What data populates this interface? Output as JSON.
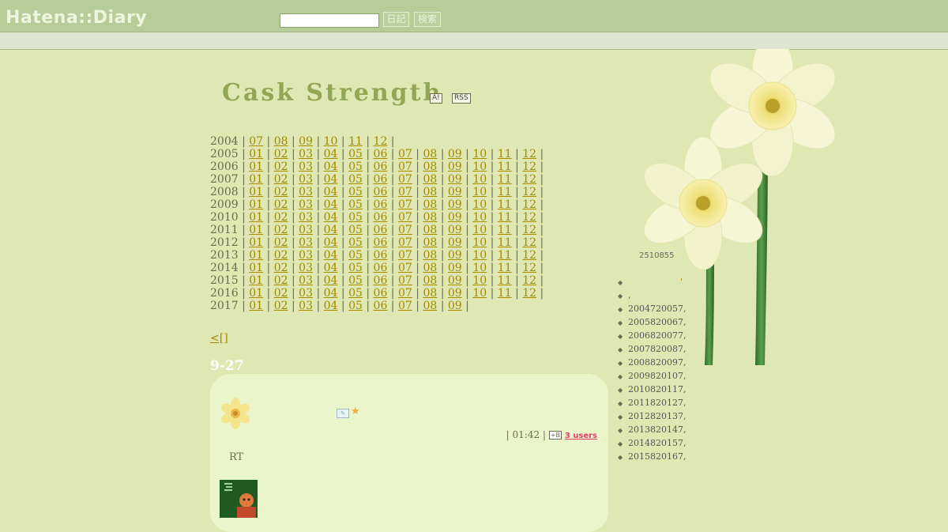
{
  "header": {
    "logo": "Hatena::Diary",
    "search_value": "",
    "diary_button": "日記",
    "search_button": "検索"
  },
  "blog": {
    "title": "Cask Strength",
    "antenna_badge": "A!",
    "rss_badge": "RSS"
  },
  "archive": [
    {
      "year": "2004",
      "months": [
        "07",
        "08",
        "09",
        "10",
        "11",
        "12"
      ]
    },
    {
      "year": "2005",
      "months": [
        "01",
        "02",
        "03",
        "04",
        "05",
        "06",
        "07",
        "08",
        "09",
        "10",
        "11",
        "12"
      ]
    },
    {
      "year": "2006",
      "months": [
        "01",
        "02",
        "03",
        "04",
        "05",
        "06",
        "07",
        "08",
        "09",
        "10",
        "11",
        "12"
      ]
    },
    {
      "year": "2007",
      "months": [
        "01",
        "02",
        "03",
        "04",
        "05",
        "06",
        "07",
        "08",
        "09",
        "10",
        "11",
        "12"
      ]
    },
    {
      "year": "2008",
      "months": [
        "01",
        "02",
        "03",
        "04",
        "05",
        "06",
        "07",
        "08",
        "09",
        "10",
        "11",
        "12"
      ]
    },
    {
      "year": "2009",
      "months": [
        "01",
        "02",
        "03",
        "04",
        "05",
        "06",
        "07",
        "08",
        "09",
        "10",
        "11",
        "12"
      ]
    },
    {
      "year": "2010",
      "months": [
        "01",
        "02",
        "03",
        "04",
        "05",
        "06",
        "07",
        "08",
        "09",
        "10",
        "11",
        "12"
      ]
    },
    {
      "year": "2011",
      "months": [
        "01",
        "02",
        "03",
        "04",
        "05",
        "06",
        "07",
        "08",
        "09",
        "10",
        "11",
        "12"
      ]
    },
    {
      "year": "2012",
      "months": [
        "01",
        "02",
        "03",
        "04",
        "05",
        "06",
        "07",
        "08",
        "09",
        "10",
        "11",
        "12"
      ]
    },
    {
      "year": "2013",
      "months": [
        "01",
        "02",
        "03",
        "04",
        "05",
        "06",
        "07",
        "08",
        "09",
        "10",
        "11",
        "12"
      ]
    },
    {
      "year": "2014",
      "months": [
        "01",
        "02",
        "03",
        "04",
        "05",
        "06",
        "07",
        "08",
        "09",
        "10",
        "11",
        "12"
      ]
    },
    {
      "year": "2015",
      "months": [
        "01",
        "02",
        "03",
        "04",
        "05",
        "06",
        "07",
        "08",
        "09",
        "10",
        "11",
        "12"
      ]
    },
    {
      "year": "2016",
      "months": [
        "01",
        "02",
        "03",
        "04",
        "05",
        "06",
        "07",
        "08",
        "09",
        "10",
        "11",
        "12"
      ]
    },
    {
      "year": "2017",
      "months": [
        "01",
        "02",
        "03",
        "04",
        "05",
        "06",
        "07",
        "08",
        "09"
      ]
    }
  ],
  "nav": {
    "prev_link": "<[]"
  },
  "entry": {
    "date": "9-27",
    "time": "| 01:42 |",
    "bookmark_icon": "+B",
    "bookmark_users": "3 users",
    "body_text": "RT",
    "icons": [
      "daffodil-icon",
      "edit-icon",
      "star-icon"
    ]
  },
  "sidebar": {
    "counter": "2510855",
    "items": [
      {
        "text": "",
        "extra": "'"
      },
      {
        "text": ",",
        "extra": ""
      },
      {
        "text": "2004720057,",
        "extra": ""
      },
      {
        "text": "2005820067,",
        "extra": ""
      },
      {
        "text": "2006820077,",
        "extra": ""
      },
      {
        "text": "2007820087,",
        "extra": ""
      },
      {
        "text": "2008820097,",
        "extra": ""
      },
      {
        "text": "2009820107,",
        "extra": ""
      },
      {
        "text": "2010820117,",
        "extra": ""
      },
      {
        "text": "2011820127,",
        "extra": ""
      },
      {
        "text": "2012820137,",
        "extra": ""
      },
      {
        "text": "2013820147,",
        "extra": ""
      },
      {
        "text": "2014820157,",
        "extra": ""
      },
      {
        "text": "2015820167,",
        "extra": ""
      }
    ]
  },
  "colors": {
    "background": "#dfe8b2",
    "topbar": "#b7cc98",
    "title": "#93a655",
    "link": "#a08b00",
    "entry_bg": "#eaf5cc",
    "users": "#e0406a"
  }
}
